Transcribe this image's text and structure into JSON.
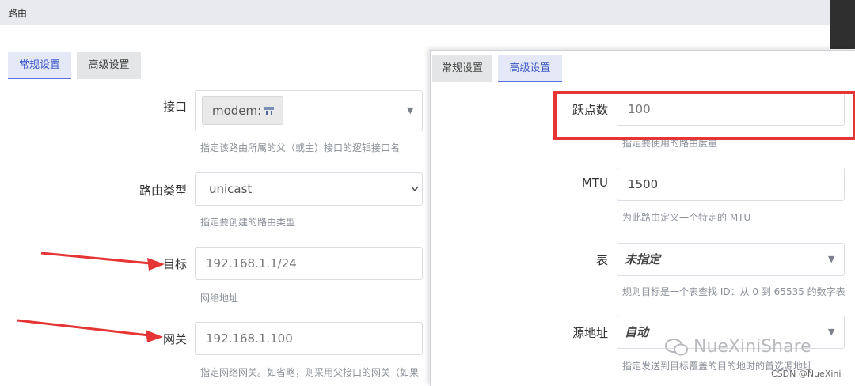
{
  "page": {
    "title": "路由"
  },
  "left": {
    "tabs": [
      {
        "label": "常规设置"
      },
      {
        "label": "高级设置"
      }
    ],
    "interface": {
      "label": "接口",
      "value": "modem:",
      "hint": "指定该路由所属的父（或主）接口的逻辑接口名"
    },
    "route_type": {
      "label": "路由类型",
      "value": "unicast",
      "hint": "指定要创建的路由类型"
    },
    "target": {
      "label": "目标",
      "value": "192.168.1.1/24",
      "hint": "网络地址"
    },
    "gateway": {
      "label": "网关",
      "value": "192.168.1.100",
      "hint": "指定网络网关。如省略，则采用父接口的网关（如果"
    }
  },
  "right": {
    "tabs": [
      {
        "label": "常规设置"
      },
      {
        "label": "高级设置"
      }
    ],
    "metric": {
      "label": "跃点数",
      "value": "100",
      "hint": "指定要使用的路由度量"
    },
    "mtu": {
      "label": "MTU",
      "value": "1500",
      "hint": "为此路由定义一个特定的 MTU"
    },
    "table": {
      "label": "表",
      "value": "未指定",
      "hint": "规则目标是一个表查找 ID：从 0 到 65535 的数字表"
    },
    "source": {
      "label": "源地址",
      "value": "自动",
      "hint": "指定发送到目标覆盖的目的地时的首选源地址"
    }
  },
  "watermark": {
    "text": "NueXiniShare",
    "credit": "CSDN @NueXini"
  },
  "colors": {
    "accent": "#3b56c9",
    "highlight": "#e53535"
  }
}
